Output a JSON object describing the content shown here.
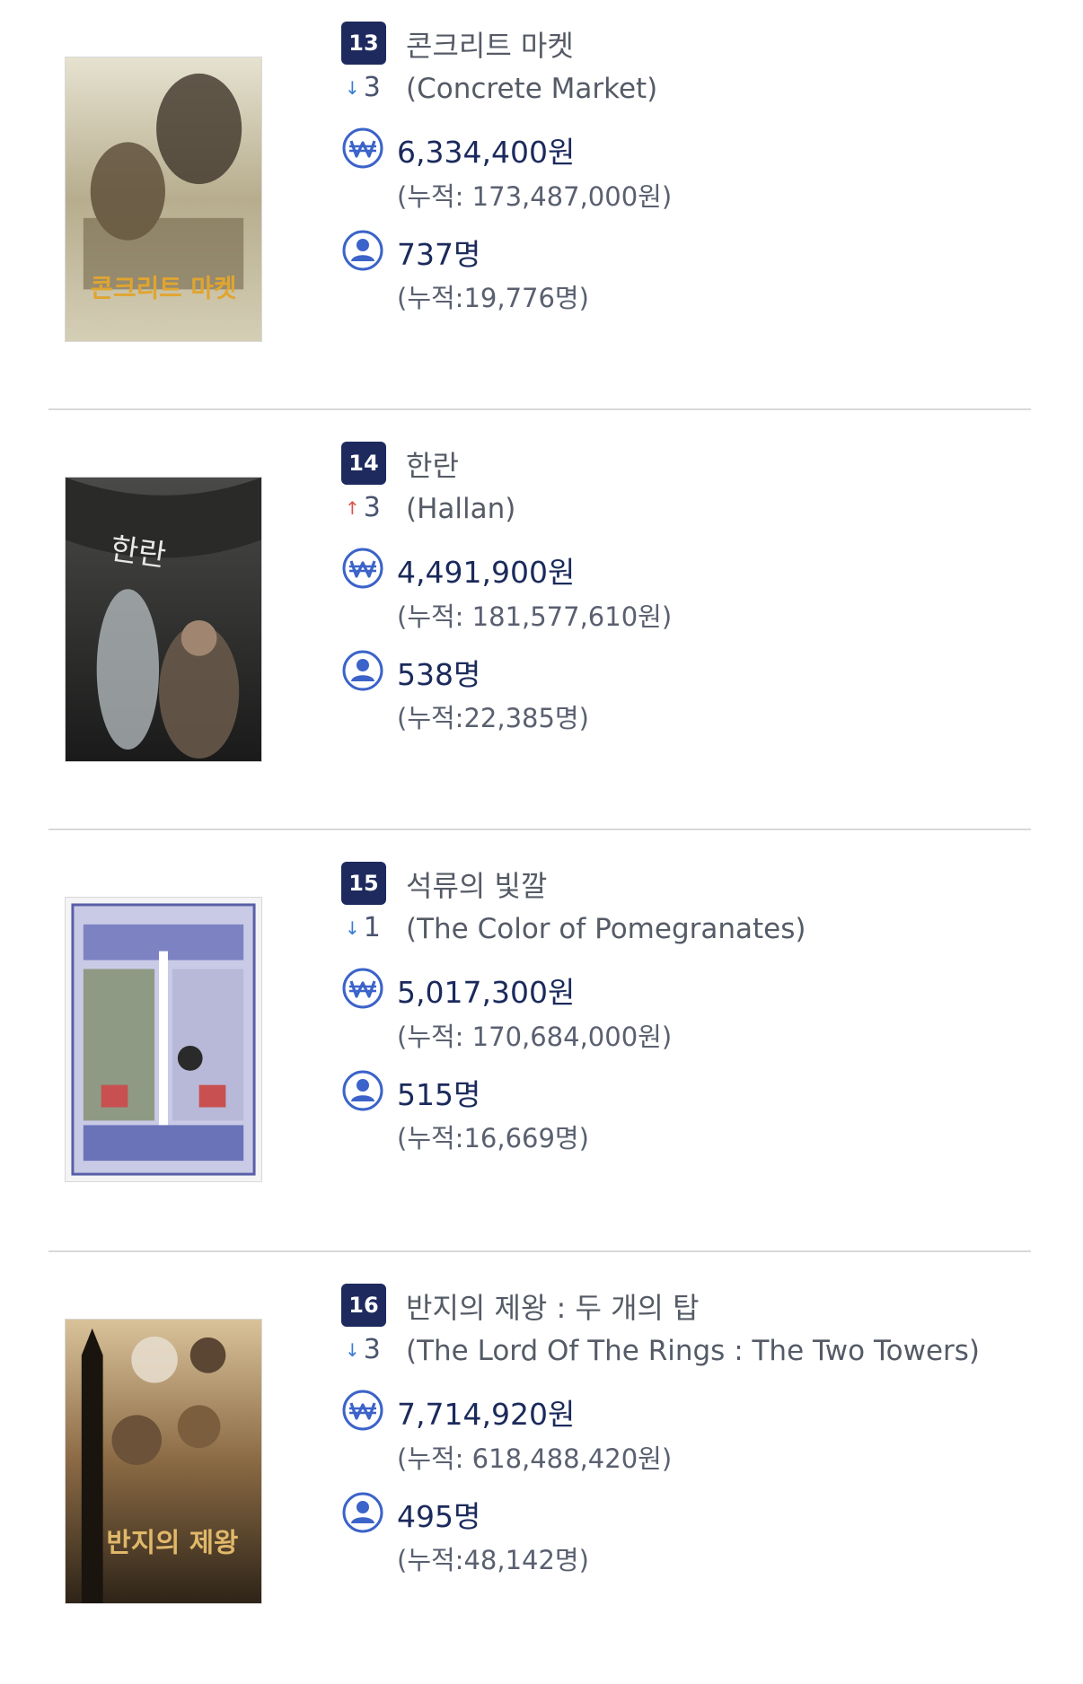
{
  "items": [
    {
      "rank": "13",
      "title": "콘크리트 마켓",
      "trend": {
        "dir": "down",
        "value": "3"
      },
      "original_title": "(Concrete Market)",
      "sales": "6,334,400원",
      "sales_total": "(누적: 173,487,000원)",
      "audience": "737명",
      "audience_total": "(누적:19,776명)",
      "poster_text": "콘크리트 마켓"
    },
    {
      "rank": "14",
      "title": "한란",
      "trend": {
        "dir": "up",
        "value": "3"
      },
      "original_title": "(Hallan)",
      "sales": "4,491,900원",
      "sales_total": "(누적: 181,577,610원)",
      "audience": "538명",
      "audience_total": "(누적:22,385명)",
      "poster_text": "한란"
    },
    {
      "rank": "15",
      "title": "석류의 빛깔",
      "trend": {
        "dir": "down",
        "value": "1"
      },
      "original_title": "(The Color of Pomegranates)",
      "sales": "5,017,300원",
      "sales_total": "(누적: 170,684,000원)",
      "audience": "515명",
      "audience_total": "(누적:16,669명)",
      "poster_text": ""
    },
    {
      "rank": "16",
      "title": "반지의 제왕 : 두 개의 탑",
      "trend": {
        "dir": "down",
        "value": "3"
      },
      "original_title": "(The Lord Of The Rings : The Two Towers)",
      "sales": "7,714,920원",
      "sales_total": "(누적: 618,488,420원)",
      "audience": "495명",
      "audience_total": "(누적:48,142명)",
      "poster_text": "반지의 제왕"
    }
  ],
  "icons": {
    "sales": "won-coin-icon",
    "audience": "person-icon",
    "trend_down": "arrow-down-icon",
    "trend_up": "arrow-up-icon"
  },
  "colors": {
    "rank_badge": "#1e2a5e",
    "icon_accent": "#3b63c9",
    "trend_down": "#3a7bd5",
    "trend_up": "#e0524a"
  }
}
